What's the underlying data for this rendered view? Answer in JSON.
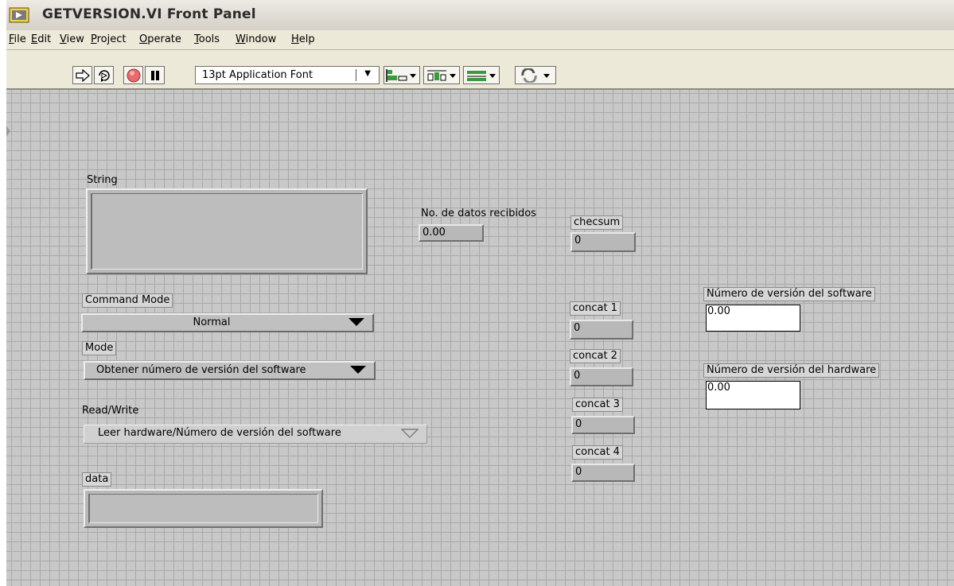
{
  "window": {
    "title": "GETVERSION.VI Front Panel"
  },
  "menu": [
    {
      "pre": "",
      "u": "F",
      "post": "ile"
    },
    {
      "pre": "",
      "u": "E",
      "post": "dit"
    },
    {
      "pre": "",
      "u": "V",
      "post": "iew"
    },
    {
      "pre": "",
      "u": "P",
      "post": "roject"
    },
    {
      "pre": "",
      "u": "O",
      "post": "perate"
    },
    {
      "pre": "",
      "u": "T",
      "post": "ools"
    },
    {
      "pre": "",
      "u": "W",
      "post": "indow"
    },
    {
      "pre": "",
      "u": "H",
      "post": "elp"
    }
  ],
  "toolbar": {
    "font_select": "13pt Application Font",
    "icons": [
      "run-arrow-icon",
      "run-continuously-icon",
      "abort-icon",
      "pause-icon",
      "align-objects-icon",
      "distribute-objects-icon",
      "resize-objects-icon",
      "reorder-icon"
    ]
  },
  "panel": {
    "string": {
      "label": "String"
    },
    "datos": {
      "label": "No. de datos recibidos",
      "value": "0.00"
    },
    "checksum": {
      "label": "checsum",
      "value": "0"
    },
    "command_mode": {
      "label": "Command Mode",
      "value": "Normal"
    },
    "mode": {
      "label": "Mode",
      "value": "Obtener número de versión del software"
    },
    "read_write": {
      "label": "Read/Write",
      "value": "Leer hardware/Número de versión del software"
    },
    "data": {
      "label": "data"
    },
    "concat1": {
      "label": "concat 1",
      "value": "0"
    },
    "concat2": {
      "label": "concat 2",
      "value": "0"
    },
    "concat3": {
      "label": "concat 3",
      "value": "0"
    },
    "concat4": {
      "label": "concat 4",
      "value": "0"
    },
    "sw_version": {
      "label": "Número de versión del software",
      "value": "0.00"
    },
    "hw_version": {
      "label": "Número de versión del hardware",
      "value": "0.00"
    }
  }
}
